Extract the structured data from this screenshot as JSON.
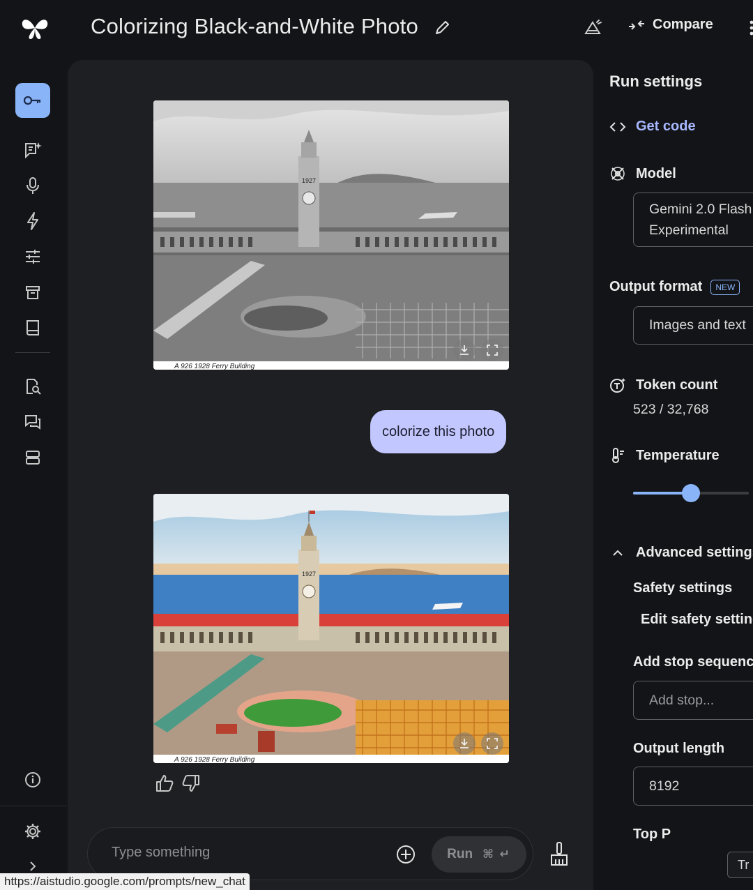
{
  "header": {
    "title": "Colorizing Black-and-White Photo",
    "compare_label": "Compare",
    "icons": {
      "logo": "gemini-studio-logo",
      "edit": "pencil-icon",
      "compare": "compare-icon",
      "more": "more-vert-icon"
    }
  },
  "rail": {
    "items": [
      {
        "name": "api-key",
        "icon": "key-icon",
        "active": true
      },
      {
        "name": "chat-prompt",
        "icon": "chat-spark-icon"
      },
      {
        "name": "stream",
        "icon": "microphone-icon"
      },
      {
        "name": "starter-apps",
        "icon": "bolt-icon"
      },
      {
        "name": "tune",
        "icon": "sliders-icon"
      },
      {
        "name": "library",
        "icon": "archive-icon"
      },
      {
        "name": "docs",
        "icon": "book-icon"
      },
      {
        "name": "search-prompts",
        "icon": "doc-search-icon"
      },
      {
        "name": "feedback",
        "icon": "forum-icon"
      },
      {
        "name": "storage",
        "icon": "storage-icon"
      },
      {
        "name": "info",
        "icon": "info-icon"
      },
      {
        "name": "settings",
        "icon": "gear-icon"
      },
      {
        "name": "expand",
        "icon": "chevron-right-icon"
      }
    ]
  },
  "chat": {
    "original_photo_caption": "A 926   1928   Ferry Building",
    "user_message": "colorize this photo",
    "colorized_photo_caption": "A 926   1928   Ferry Building",
    "tower_sign": "1927",
    "composer": {
      "placeholder": "Type something",
      "run_label": "Run",
      "run_shortcut": "⌘ ↵"
    }
  },
  "settings": {
    "heading": "Run settings",
    "get_code": "Get code",
    "model_label": "Model",
    "model_value_line1": "Gemini 2.0 Flash",
    "model_value_line2": "Experimental",
    "output_format_label": "Output format",
    "new_badge": "NEW",
    "output_format_value": "Images and text",
    "token_count_label": "Token count",
    "token_count_value": "523 / 32,768",
    "temperature_label": "Temperature",
    "temperature_fraction": 0.5,
    "advanced_label": "Advanced settings",
    "safety_label": "Safety settings",
    "edit_safety_label": "Edit safety settings",
    "stop_sequence_label": "Add stop sequence",
    "stop_sequence_placeholder": "Add stop...",
    "output_length_label": "Output length",
    "output_length_value": "8192",
    "top_p_label": "Top P",
    "tr_chip": "Tr"
  },
  "status_url": "https://aistudio.google.com/prompts/new_chat",
  "colors": {
    "accent": "#8ab4f8",
    "user_bubble": "#c2c8ff",
    "link": "#a8b8ff"
  }
}
